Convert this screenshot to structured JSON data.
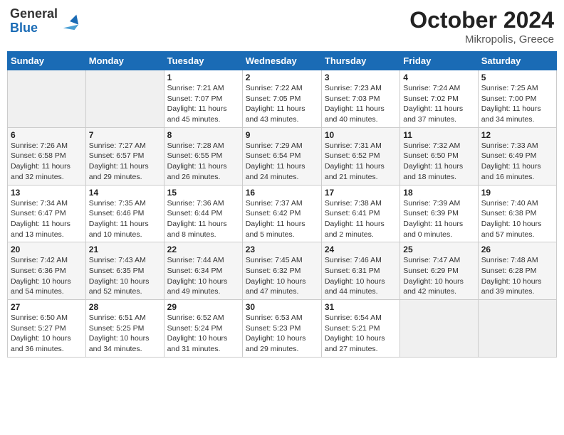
{
  "header": {
    "logo_line1": "General",
    "logo_line2": "Blue",
    "month_year": "October 2024",
    "location": "Mikropolis, Greece"
  },
  "days_of_week": [
    "Sunday",
    "Monday",
    "Tuesday",
    "Wednesday",
    "Thursday",
    "Friday",
    "Saturday"
  ],
  "weeks": [
    [
      {
        "day": null,
        "text": null
      },
      {
        "day": null,
        "text": null
      },
      {
        "day": "1",
        "text": "Sunrise: 7:21 AM\nSunset: 7:07 PM\nDaylight: 11 hours and 45 minutes."
      },
      {
        "day": "2",
        "text": "Sunrise: 7:22 AM\nSunset: 7:05 PM\nDaylight: 11 hours and 43 minutes."
      },
      {
        "day": "3",
        "text": "Sunrise: 7:23 AM\nSunset: 7:03 PM\nDaylight: 11 hours and 40 minutes."
      },
      {
        "day": "4",
        "text": "Sunrise: 7:24 AM\nSunset: 7:02 PM\nDaylight: 11 hours and 37 minutes."
      },
      {
        "day": "5",
        "text": "Sunrise: 7:25 AM\nSunset: 7:00 PM\nDaylight: 11 hours and 34 minutes."
      }
    ],
    [
      {
        "day": "6",
        "text": "Sunrise: 7:26 AM\nSunset: 6:58 PM\nDaylight: 11 hours and 32 minutes."
      },
      {
        "day": "7",
        "text": "Sunrise: 7:27 AM\nSunset: 6:57 PM\nDaylight: 11 hours and 29 minutes."
      },
      {
        "day": "8",
        "text": "Sunrise: 7:28 AM\nSunset: 6:55 PM\nDaylight: 11 hours and 26 minutes."
      },
      {
        "day": "9",
        "text": "Sunrise: 7:29 AM\nSunset: 6:54 PM\nDaylight: 11 hours and 24 minutes."
      },
      {
        "day": "10",
        "text": "Sunrise: 7:31 AM\nSunset: 6:52 PM\nDaylight: 11 hours and 21 minutes."
      },
      {
        "day": "11",
        "text": "Sunrise: 7:32 AM\nSunset: 6:50 PM\nDaylight: 11 hours and 18 minutes."
      },
      {
        "day": "12",
        "text": "Sunrise: 7:33 AM\nSunset: 6:49 PM\nDaylight: 11 hours and 16 minutes."
      }
    ],
    [
      {
        "day": "13",
        "text": "Sunrise: 7:34 AM\nSunset: 6:47 PM\nDaylight: 11 hours and 13 minutes."
      },
      {
        "day": "14",
        "text": "Sunrise: 7:35 AM\nSunset: 6:46 PM\nDaylight: 11 hours and 10 minutes."
      },
      {
        "day": "15",
        "text": "Sunrise: 7:36 AM\nSunset: 6:44 PM\nDaylight: 11 hours and 8 minutes."
      },
      {
        "day": "16",
        "text": "Sunrise: 7:37 AM\nSunset: 6:42 PM\nDaylight: 11 hours and 5 minutes."
      },
      {
        "day": "17",
        "text": "Sunrise: 7:38 AM\nSunset: 6:41 PM\nDaylight: 11 hours and 2 minutes."
      },
      {
        "day": "18",
        "text": "Sunrise: 7:39 AM\nSunset: 6:39 PM\nDaylight: 11 hours and 0 minutes."
      },
      {
        "day": "19",
        "text": "Sunrise: 7:40 AM\nSunset: 6:38 PM\nDaylight: 10 hours and 57 minutes."
      }
    ],
    [
      {
        "day": "20",
        "text": "Sunrise: 7:42 AM\nSunset: 6:36 PM\nDaylight: 10 hours and 54 minutes."
      },
      {
        "day": "21",
        "text": "Sunrise: 7:43 AM\nSunset: 6:35 PM\nDaylight: 10 hours and 52 minutes."
      },
      {
        "day": "22",
        "text": "Sunrise: 7:44 AM\nSunset: 6:34 PM\nDaylight: 10 hours and 49 minutes."
      },
      {
        "day": "23",
        "text": "Sunrise: 7:45 AM\nSunset: 6:32 PM\nDaylight: 10 hours and 47 minutes."
      },
      {
        "day": "24",
        "text": "Sunrise: 7:46 AM\nSunset: 6:31 PM\nDaylight: 10 hours and 44 minutes."
      },
      {
        "day": "25",
        "text": "Sunrise: 7:47 AM\nSunset: 6:29 PM\nDaylight: 10 hours and 42 minutes."
      },
      {
        "day": "26",
        "text": "Sunrise: 7:48 AM\nSunset: 6:28 PM\nDaylight: 10 hours and 39 minutes."
      }
    ],
    [
      {
        "day": "27",
        "text": "Sunrise: 6:50 AM\nSunset: 5:27 PM\nDaylight: 10 hours and 36 minutes."
      },
      {
        "day": "28",
        "text": "Sunrise: 6:51 AM\nSunset: 5:25 PM\nDaylight: 10 hours and 34 minutes."
      },
      {
        "day": "29",
        "text": "Sunrise: 6:52 AM\nSunset: 5:24 PM\nDaylight: 10 hours and 31 minutes."
      },
      {
        "day": "30",
        "text": "Sunrise: 6:53 AM\nSunset: 5:23 PM\nDaylight: 10 hours and 29 minutes."
      },
      {
        "day": "31",
        "text": "Sunrise: 6:54 AM\nSunset: 5:21 PM\nDaylight: 10 hours and 27 minutes."
      },
      {
        "day": null,
        "text": null
      },
      {
        "day": null,
        "text": null
      }
    ]
  ]
}
